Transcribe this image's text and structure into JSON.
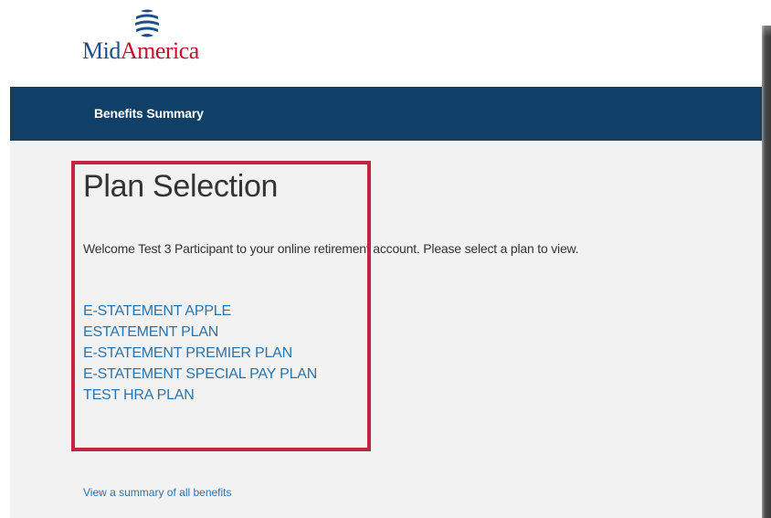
{
  "header": {
    "logo": {
      "text_part1": "Mid",
      "text_part2": "America",
      "icon": "midamerica-globe-icon"
    }
  },
  "nav": {
    "items": [
      {
        "label": "Benefits Summary"
      }
    ]
  },
  "main": {
    "title": "Plan Selection",
    "welcome_text": "Welcome Test 3 Participant to your online retirement account. Please select a plan to view.",
    "plans": [
      {
        "label": "E-STATEMENT APPLE"
      },
      {
        "label": "ESTATEMENT PLAN"
      },
      {
        "label": "E-STATEMENT PREMIER PLAN"
      },
      {
        "label": "E-STATEMENT SPECIAL PAY PLAN"
      },
      {
        "label": "TEST HRA PLAN"
      }
    ],
    "summary_link": "View a summary of all benefits"
  },
  "colors": {
    "nav_background": "#104068",
    "content_background": "#f2f2f2",
    "link": "#2a74ad",
    "highlight_border": "#c3243f",
    "logo_blue": "#1a4f8a",
    "logo_red": "#c8102e"
  }
}
